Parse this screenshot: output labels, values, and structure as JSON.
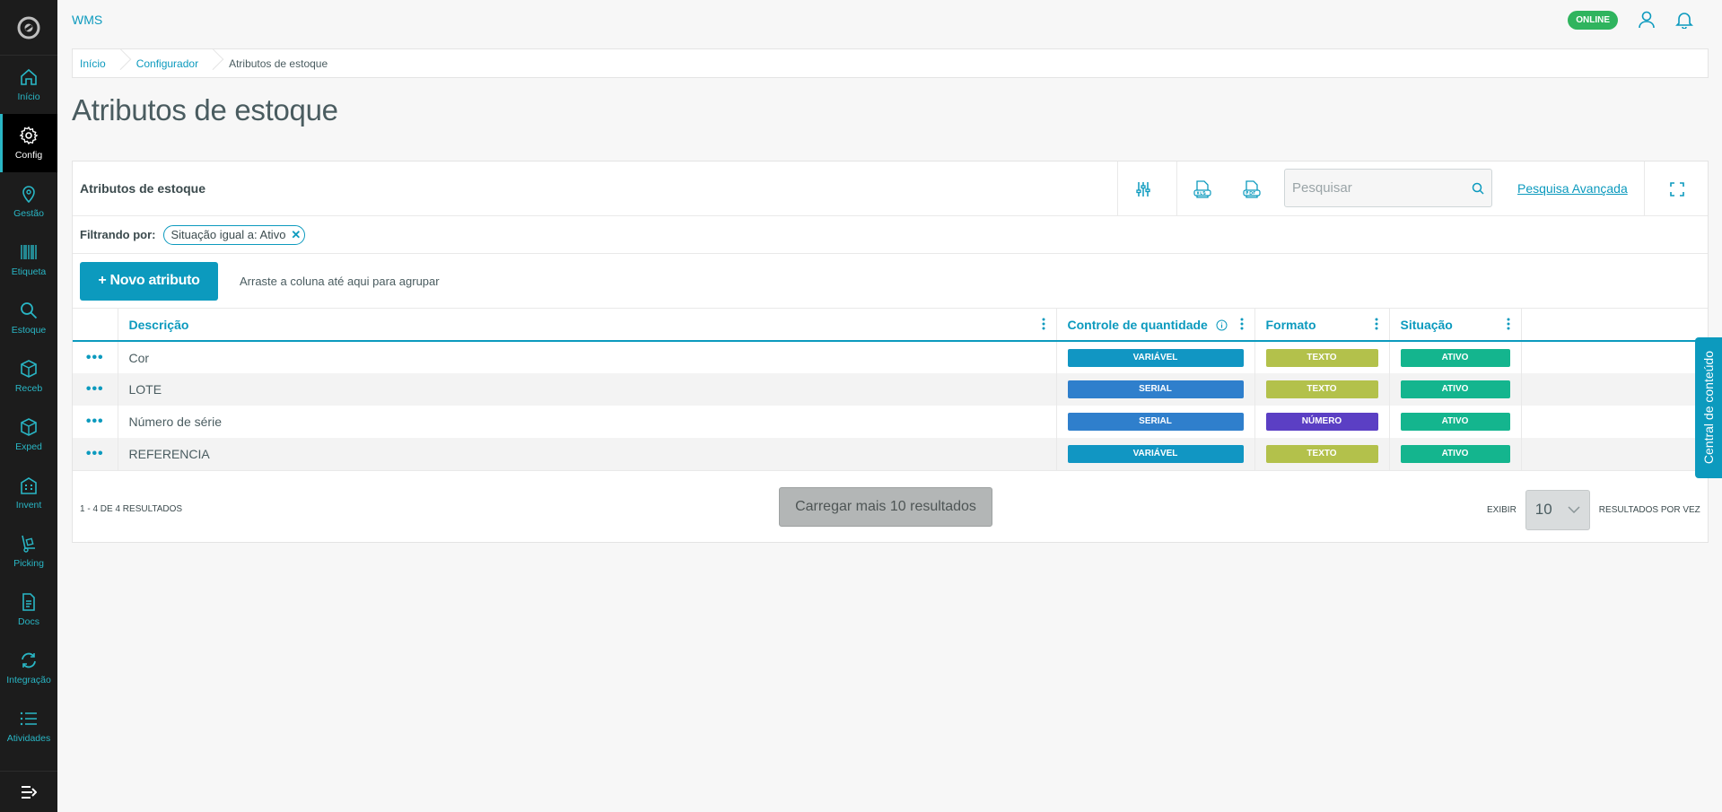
{
  "app": {
    "title": "WMS",
    "status": "ONLINE"
  },
  "sidebar": {
    "items": [
      {
        "label": "Início",
        "icon": "home-icon"
      },
      {
        "label": "Config",
        "icon": "gear-icon"
      },
      {
        "label": "Gestão",
        "icon": "location-pin-icon"
      },
      {
        "label": "Etiqueta",
        "icon": "barcode-icon"
      },
      {
        "label": "Estoque",
        "icon": "search-icon"
      },
      {
        "label": "Receb",
        "icon": "box-icon"
      },
      {
        "label": "Exped",
        "icon": "box-icon"
      },
      {
        "label": "Invent",
        "icon": "building-icon"
      },
      {
        "label": "Picking",
        "icon": "hand-truck-icon"
      },
      {
        "label": "Docs",
        "icon": "document-icon"
      },
      {
        "label": "Integração",
        "icon": "sync-icon"
      },
      {
        "label": "Atividades",
        "icon": "list-icon"
      }
    ],
    "active": "Config"
  },
  "breadcrumb": [
    "Início",
    "Configurador",
    "Atributos de estoque"
  ],
  "page": {
    "title": "Atributos de estoque"
  },
  "card": {
    "title": "Atributos de estoque",
    "search_placeholder": "Pesquisar",
    "advanced_search": "Pesquisa Avançada",
    "filter_label": "Filtrando por:",
    "filter_chip": "Situação igual a: Ativo",
    "new_button": "+ Novo atributo",
    "group_hint": "Arraste a coluna até aqui para agrupar"
  },
  "table": {
    "columns": [
      "Descrição",
      "Controle de quantidade",
      "Formato",
      "Situação"
    ],
    "rows": [
      {
        "descricao": "Cor",
        "controle": "VARIÁVEL",
        "formato": "TEXTO",
        "situacao": "ATIVO"
      },
      {
        "descricao": "LOTE",
        "controle": "SERIAL",
        "formato": "TEXTO",
        "situacao": "ATIVO"
      },
      {
        "descricao": "Número de série",
        "controle": "SERIAL",
        "formato": "NÚMERO",
        "situacao": "ATIVO"
      },
      {
        "descricao": "REFERENCIA",
        "controle": "VARIÁVEL",
        "formato": "TEXTO",
        "situacao": "ATIVO"
      }
    ]
  },
  "tag_colors": {
    "VARIÁVEL": "#1196c3",
    "SERIAL": "#2f7fcc",
    "TEXTO": "#b3c14b",
    "NÚMERO": "#5b3fc4",
    "ATIVO": "#14b58e"
  },
  "footer": {
    "range": "1 - 4 DE 4 RESULTADOS",
    "load_more": "Carregar mais 10 resultados",
    "show_label": "EXIBIR",
    "page_size": "10",
    "per_page_label": "RESULTADOS POR VEZ"
  },
  "side_tab": {
    "label": "Central de conteúdo"
  }
}
